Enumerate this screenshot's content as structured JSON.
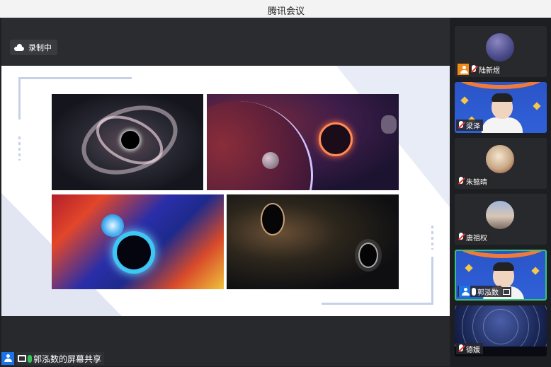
{
  "window": {
    "title": "腾讯会议"
  },
  "recording": {
    "label": "录制中"
  },
  "share": {
    "label": "郭泓数的屏幕共享"
  },
  "participants": [
    {
      "name": "陆新煜",
      "host": true,
      "muted": true
    },
    {
      "name": "梁泽",
      "muted": true
    },
    {
      "name": "朱懿晴",
      "muted": true
    },
    {
      "name": "唐祖权",
      "muted": true
    },
    {
      "name": "郭泓数",
      "active": true,
      "muted": false
    },
    {
      "name": "德媛",
      "muted": true
    }
  ],
  "colors": {
    "accent": "#1a73e8",
    "active_border": "#36c47a",
    "host_badge": "#f08a1a",
    "mute": "#e53935"
  }
}
